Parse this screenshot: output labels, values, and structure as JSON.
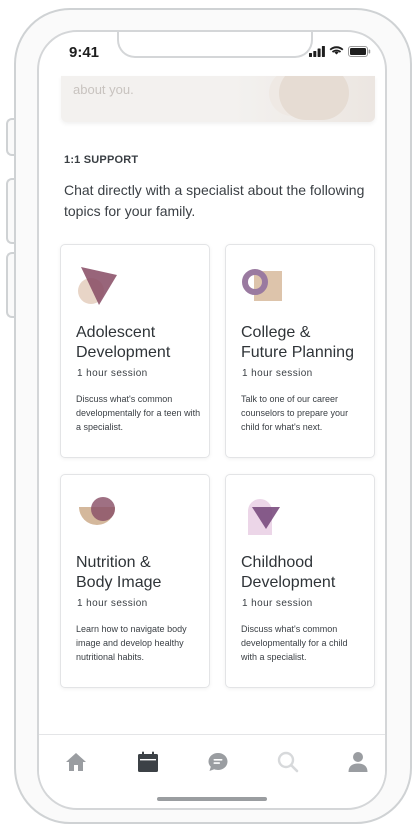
{
  "status_bar": {
    "time": "9:41"
  },
  "hero": {
    "caption": "about you."
  },
  "section": {
    "label": "1:1 SUPPORT",
    "intro": "Chat directly with a specialist about the following topics for your family."
  },
  "cards": [
    {
      "title_line1": "Adolescent",
      "title_line2": "Development",
      "session": "1 hour session",
      "description": "Discuss what's common developmentally for a teen with a specialist.",
      "icon": "triangle-circle-icon"
    },
    {
      "title_line1": "College &",
      "title_line2": "Future Planning",
      "session": "1 hour session",
      "description": "Talk to one of our career counselors to prepare your child for what's next.",
      "icon": "ring-square-icon"
    },
    {
      "title_line1": "Nutrition &",
      "title_line2": "Body Image",
      "session": "1 hour session",
      "description": "Learn how to navigate body image and develop healthy nutritional habits.",
      "icon": "half-circle-icon"
    },
    {
      "title_line1": "Childhood",
      "title_line2": "Development",
      "session": "1 hour session",
      "description": "Discuss what's common developmentally for a child with a specialist.",
      "icon": "triangle-arch-icon"
    }
  ],
  "tabbar": {
    "items": [
      "home-icon",
      "calendar-icon",
      "chat-icon",
      "search-icon",
      "profile-icon"
    ],
    "active": "calendar-icon"
  },
  "colors": {
    "plum": "#8a5068",
    "sand": "#d9c2ab",
    "lavender": "#9a7aa0",
    "pink": "#e8d2e4",
    "icon_gray": "#9a9da1",
    "icon_dark": "#3c4146"
  }
}
